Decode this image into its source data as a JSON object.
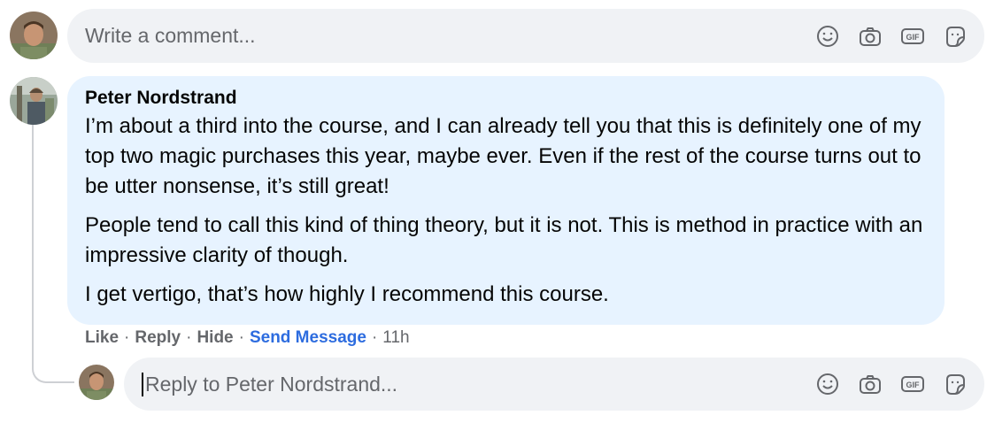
{
  "top_comment": {
    "placeholder": "Write a comment..."
  },
  "comment": {
    "author": "Peter Nordstrand",
    "paragraphs": [
      "I’m about a third into the course, and I can already tell you that this is definitely one of my top two magic purchases this year, maybe ever. Even if the rest of the course turns out to be utter nonsense, it’s still great!",
      "People tend to call this kind of thing theory, but it is not. This is method in practice with an impressive clarity of though.",
      "I get vertigo, that’s how highly I recommend this course."
    ],
    "actions": {
      "like": "Like",
      "reply": "Reply",
      "hide": "Hide",
      "send_message": "Send Message",
      "separator": "·",
      "time": "11h"
    }
  },
  "reply": {
    "placeholder": "Reply to Peter Nordstrand..."
  },
  "icons": [
    "emoji-icon",
    "camera-icon",
    "gif-icon",
    "sticker-icon"
  ],
  "colors": {
    "input_bg": "#f0f2f5",
    "bubble_bg": "#e7f3ff",
    "secondary_text": "#65676b",
    "link_blue": "#2d6cdf"
  }
}
